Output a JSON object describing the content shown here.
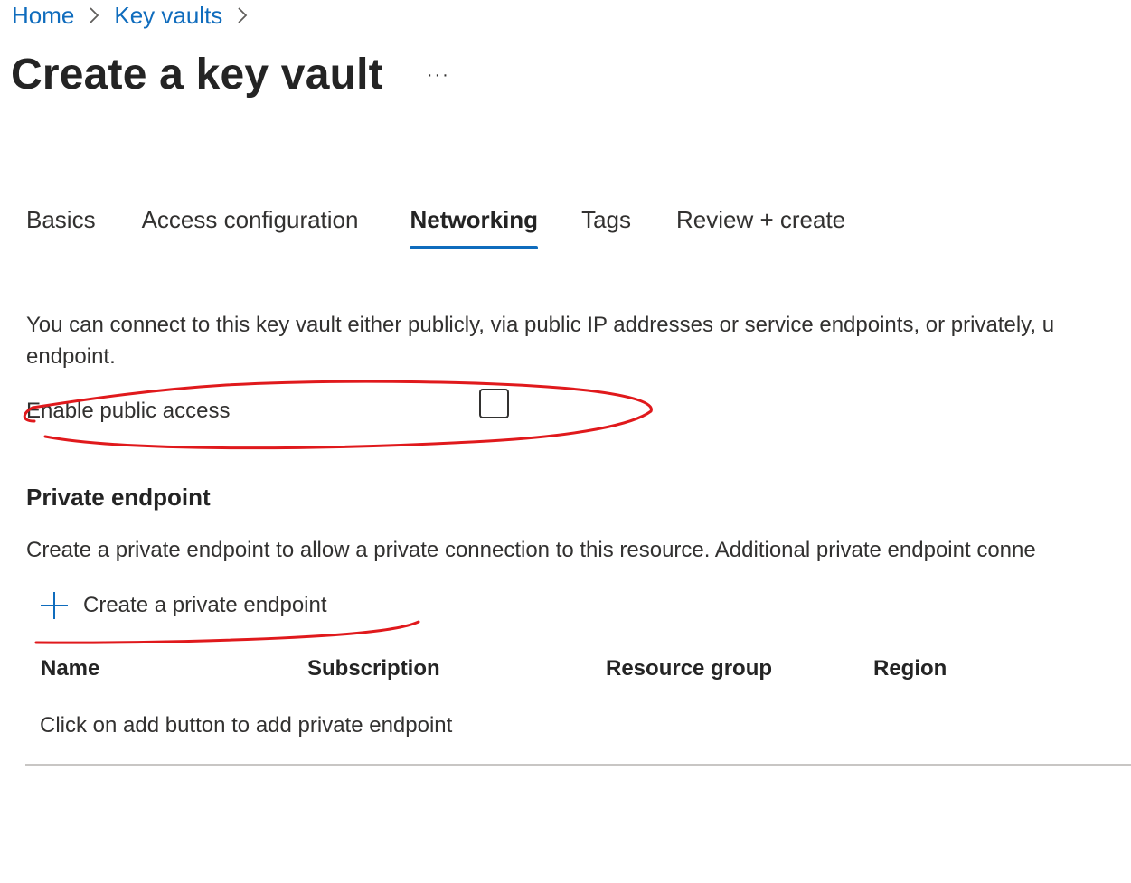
{
  "breadcrumb": {
    "items": [
      {
        "label": "Home"
      },
      {
        "label": "Key vaults"
      }
    ],
    "separator_icon": "chevron-right-icon"
  },
  "header": {
    "title": "Create a key vault",
    "more_label": "···"
  },
  "tabs": [
    {
      "label": "Basics",
      "active": false
    },
    {
      "label": "Access configuration",
      "active": false
    },
    {
      "label": "Networking",
      "active": true
    },
    {
      "label": "Tags",
      "active": false
    },
    {
      "label": "Review + create",
      "active": false
    }
  ],
  "networking": {
    "intro_line1": "You can connect to this key vault either publicly, via public IP addresses or service endpoints, or privately, u",
    "intro_line2": "endpoint.",
    "public_access_label": "Enable public access",
    "public_access_checked": false
  },
  "private_endpoint": {
    "title": "Private endpoint",
    "description": "Create a private endpoint to allow a private connection to this resource. Additional private endpoint conne",
    "create_button_label": "Create a private endpoint",
    "create_button_icon": "plus-icon",
    "table": {
      "columns": [
        "Name",
        "Subscription",
        "Resource group",
        "Region"
      ],
      "empty_text": "Click on add button to add private endpoint"
    }
  },
  "colors": {
    "accent": "#0f6cbd",
    "annotation": "#e0191c",
    "text": "#323130"
  }
}
